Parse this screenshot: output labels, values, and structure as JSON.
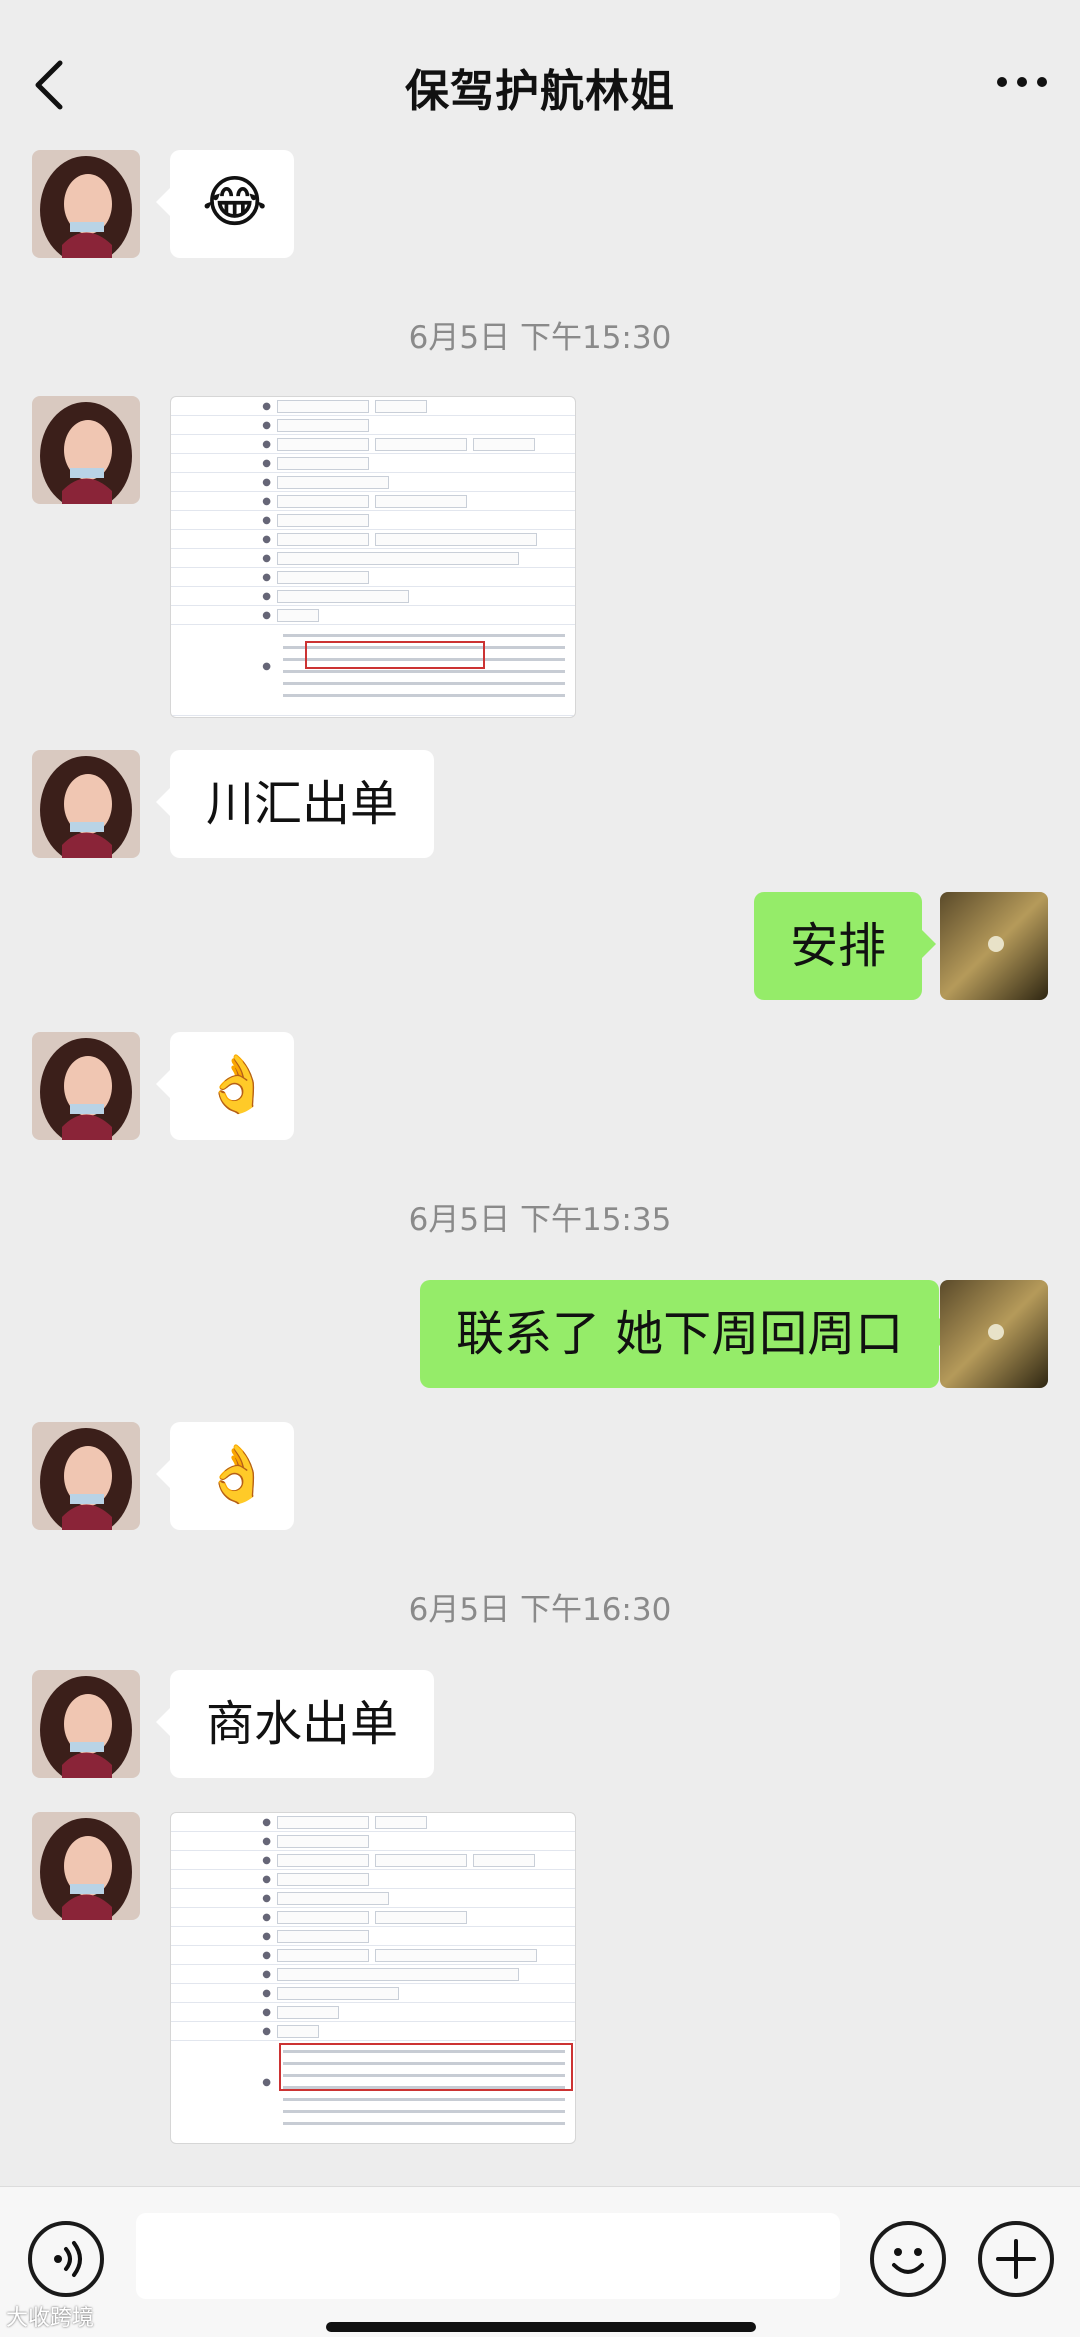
{
  "header": {
    "title": "保驾护航林姐",
    "back_icon": "chevron-left-icon",
    "more_icon": "ellipsis-icon"
  },
  "messages": {
    "m1_emoji": "😂",
    "ts1": "6月5日 下午15:30",
    "m3_text": "川汇出单",
    "m4_text": "安排",
    "m5_emoji": "👌",
    "ts2": "6月5日 下午15:35",
    "m6_text": "联系了 她下周回周口",
    "m7_emoji": "👌",
    "ts3": "6月5日 下午16:30",
    "m8_text": "商水出单"
  },
  "composer": {
    "voice_icon": "voice-icon",
    "emoji_icon": "smiley-icon",
    "plus_icon": "plus-icon",
    "input_value": ""
  },
  "watermark": "大收跨境",
  "colors": {
    "background": "#ededed",
    "sent_bubble": "#95ec69",
    "received_bubble": "#ffffff",
    "timestamp": "#8a8a8a"
  }
}
